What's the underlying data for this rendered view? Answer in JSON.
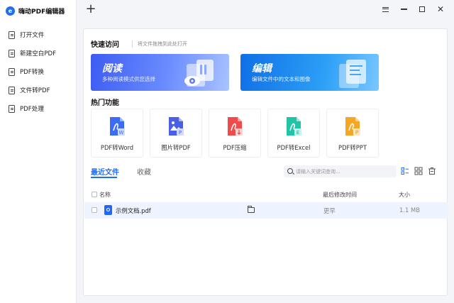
{
  "app": {
    "title": "嗨动PDF编辑器",
    "logo_glyph": "e",
    "accent": "#1e6ff2"
  },
  "sidebar": {
    "items": [
      {
        "label": "打开文件",
        "icon": "open-file-icon"
      },
      {
        "label": "新建空白PDF",
        "icon": "new-pdf-icon"
      },
      {
        "label": "PDF转换",
        "icon": "convert-icon"
      },
      {
        "label": "文件转PDF",
        "icon": "file-to-pdf-icon"
      },
      {
        "label": "PDF处理",
        "icon": "process-icon"
      }
    ]
  },
  "topbar": {
    "add_tab": "+",
    "close_glyph": "✕"
  },
  "quick_access": {
    "title": "快速访问",
    "hint": "将文件拖拽到此处打开",
    "banners": [
      {
        "title": "阅读",
        "subtitle": "多种阅读模式供您选择",
        "color": "#4a6cf7"
      },
      {
        "title": "编辑",
        "subtitle": "编辑文件中的文本和图像",
        "color": "#1a86f0"
      }
    ]
  },
  "hot_features": {
    "title": "热门功能",
    "items": [
      {
        "label": "PDF转Word",
        "color": "#3b6cf5",
        "icon": "pdf-to-word-icon"
      },
      {
        "label": "图片转PDF",
        "color": "#4a5fe8",
        "icon": "image-to-pdf-icon"
      },
      {
        "label": "PDF压缩",
        "color": "#f04a4a",
        "icon": "pdf-compress-icon"
      },
      {
        "label": "PDF转Excel",
        "color": "#22c3a6",
        "icon": "pdf-to-excel-icon"
      },
      {
        "label": "PDF转PPT",
        "color": "#f5a623",
        "icon": "pdf-to-ppt-icon"
      }
    ]
  },
  "recent": {
    "tabs": {
      "recent": "最近文件",
      "favorites": "收藏"
    },
    "search_placeholder": "请输入关键词查询...",
    "columns": {
      "name": "名称",
      "modified": "最后修改时间",
      "size": "大小"
    },
    "rows": [
      {
        "name": "示例文档.pdf",
        "modified": "更早",
        "size": "1.1 MB"
      }
    ]
  }
}
